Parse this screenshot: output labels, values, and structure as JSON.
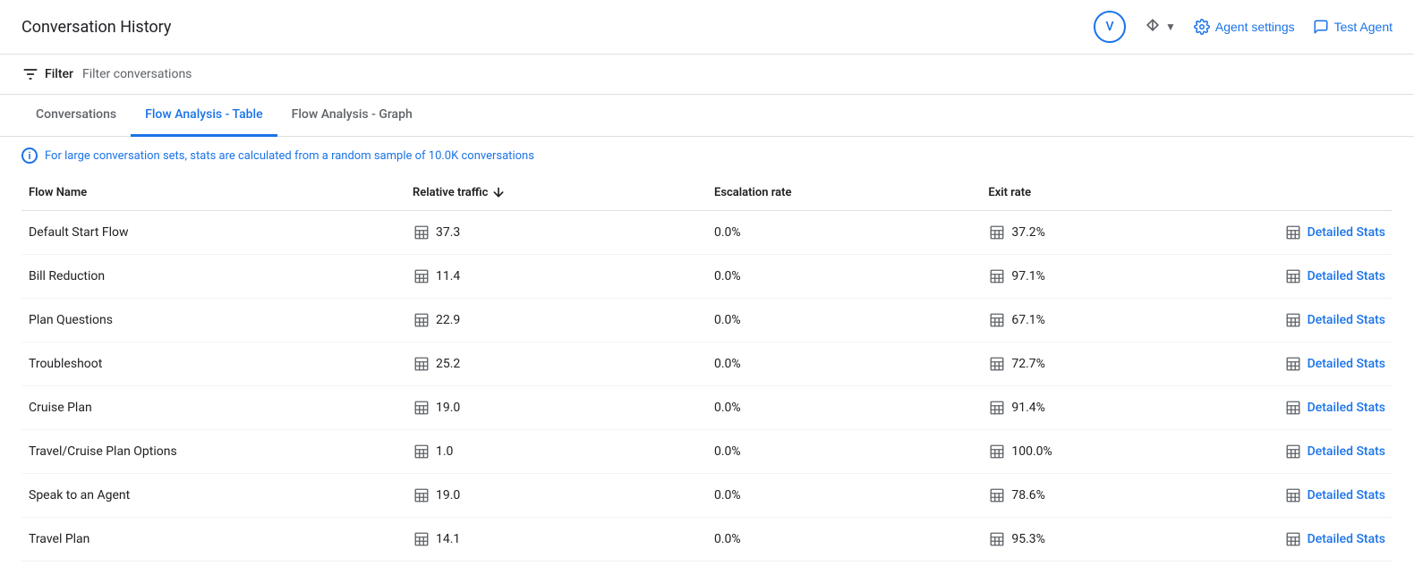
{
  "header": {
    "title": "Conversation History",
    "avatar_label": "V",
    "agent_settings_label": "Agent settings",
    "test_agent_label": "Test Agent"
  },
  "filter_bar": {
    "filter_label": "Filter",
    "filter_placeholder": "Filter conversations"
  },
  "tabs": [
    {
      "id": "conversations",
      "label": "Conversations",
      "active": false
    },
    {
      "id": "flow-analysis-table",
      "label": "Flow Analysis - Table",
      "active": true
    },
    {
      "id": "flow-analysis-graph",
      "label": "Flow Analysis - Graph",
      "active": false
    }
  ],
  "info_banner": {
    "text": "For large conversation sets, stats are calculated from a random sample of 10.0K conversations"
  },
  "table": {
    "columns": [
      {
        "id": "flow-name",
        "label": "Flow Name",
        "sortable": false
      },
      {
        "id": "relative-traffic",
        "label": "Relative traffic",
        "sortable": true
      },
      {
        "id": "escalation-rate",
        "label": "Escalation rate",
        "sortable": false
      },
      {
        "id": "exit-rate",
        "label": "Exit rate",
        "sortable": false
      },
      {
        "id": "actions",
        "label": "",
        "sortable": false
      }
    ],
    "rows": [
      {
        "flow_name": "Default Start Flow",
        "relative_traffic": "37.3",
        "escalation_rate": "0.0%",
        "exit_rate": "37.2%",
        "detailed_stats_label": "Detailed Stats"
      },
      {
        "flow_name": "Bill Reduction",
        "relative_traffic": "11.4",
        "escalation_rate": "0.0%",
        "exit_rate": "97.1%",
        "detailed_stats_label": "Detailed Stats"
      },
      {
        "flow_name": "Plan Questions",
        "relative_traffic": "22.9",
        "escalation_rate": "0.0%",
        "exit_rate": "67.1%",
        "detailed_stats_label": "Detailed Stats"
      },
      {
        "flow_name": "Troubleshoot",
        "relative_traffic": "25.2",
        "escalation_rate": "0.0%",
        "exit_rate": "72.7%",
        "detailed_stats_label": "Detailed Stats"
      },
      {
        "flow_name": "Cruise Plan",
        "relative_traffic": "19.0",
        "escalation_rate": "0.0%",
        "exit_rate": "91.4%",
        "detailed_stats_label": "Detailed Stats"
      },
      {
        "flow_name": "Travel/Cruise Plan Options",
        "relative_traffic": "1.0",
        "escalation_rate": "0.0%",
        "exit_rate": "100.0%",
        "detailed_stats_label": "Detailed Stats"
      },
      {
        "flow_name": "Speak to an Agent",
        "relative_traffic": "19.0",
        "escalation_rate": "0.0%",
        "exit_rate": "78.6%",
        "detailed_stats_label": "Detailed Stats"
      },
      {
        "flow_name": "Travel Plan",
        "relative_traffic": "14.1",
        "escalation_rate": "0.0%",
        "exit_rate": "95.3%",
        "detailed_stats_label": "Detailed Stats"
      }
    ]
  }
}
